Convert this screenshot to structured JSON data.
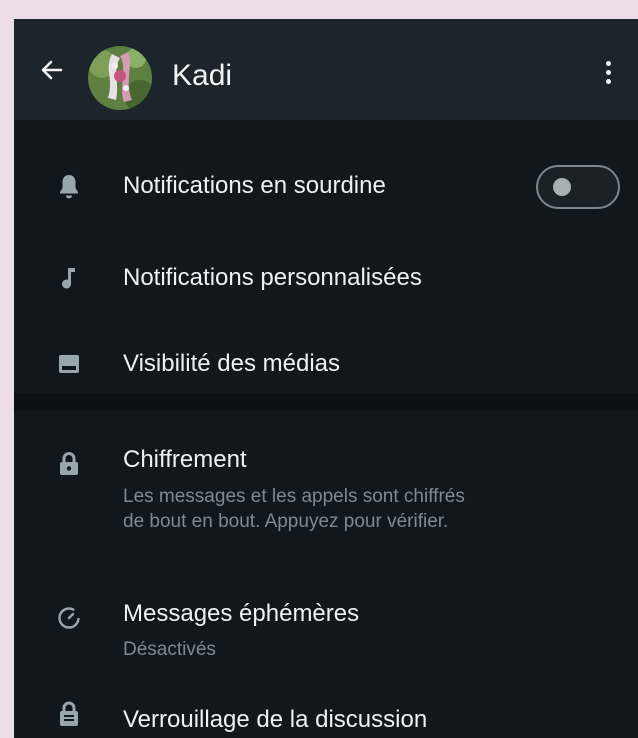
{
  "header": {
    "contact_name": "Kadi",
    "back_icon": "arrow-left-icon",
    "menu_icon": "more-vertical-icon"
  },
  "settings": {
    "mute": {
      "label": "Notifications en sourdine",
      "icon": "bell-icon",
      "enabled": false
    },
    "custom_notifications": {
      "label": "Notifications personnalisées",
      "icon": "music-note-icon"
    },
    "media_visibility": {
      "label": "Visibilité des médias",
      "icon": "image-icon"
    },
    "encryption": {
      "label": "Chiffrement",
      "description_line1": "Les messages et les appels sont chiffrés",
      "description_line2": "de bout en bout. Appuyez pour vérifier.",
      "icon": "lock-icon"
    },
    "disappearing": {
      "label": "Messages éphémères",
      "status": "Désactivés",
      "icon": "timer-icon"
    },
    "chat_lock": {
      "label": "Verrouillage de la discussion",
      "icon": "chat-lock-icon"
    }
  },
  "colors": {
    "background": "#10161b",
    "app_bar": "#1c252b",
    "text_primary": "#eef1f3",
    "text_secondary": "#7c8a93",
    "icon": "#9aa6ad"
  }
}
